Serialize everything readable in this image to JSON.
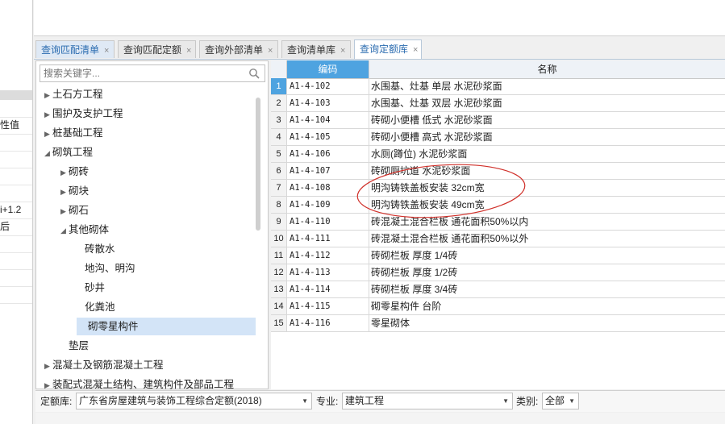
{
  "left_panel": {
    "rows": [
      {
        "text": ""
      },
      {
        "text": "性值"
      },
      {
        "text": ""
      },
      {
        "text": ""
      },
      {
        "text": ""
      },
      {
        "text": ""
      },
      {
        "text": "i+1.2"
      },
      {
        "text": "后"
      },
      {
        "text": ""
      },
      {
        "text": ""
      },
      {
        "text": ""
      },
      {
        "text": ""
      }
    ]
  },
  "tabs": [
    {
      "label": "查询匹配清单",
      "close": "×"
    },
    {
      "label": "查询匹配定额",
      "close": "×"
    },
    {
      "label": "查询外部清单",
      "close": "×"
    },
    {
      "label": "查询清单库",
      "close": "×"
    },
    {
      "label": "查询定额库",
      "close": "×"
    }
  ],
  "search": {
    "placeholder": "搜索关键字..."
  },
  "tree": [
    {
      "label": "土石方工程",
      "arrow": "▶"
    },
    {
      "label": "围护及支护工程",
      "arrow": "▶"
    },
    {
      "label": "桩基础工程",
      "arrow": "▶"
    },
    {
      "label": "砌筑工程",
      "arrow": "◢"
    },
    {
      "label": "砌砖",
      "arrow": "▶"
    },
    {
      "label": "砌块",
      "arrow": "▶"
    },
    {
      "label": "砌石",
      "arrow": "▶"
    },
    {
      "label": "其他砌体",
      "arrow": "◢"
    },
    {
      "label": "砖散水",
      "arrow": ""
    },
    {
      "label": "地沟、明沟",
      "arrow": ""
    },
    {
      "label": "砂井",
      "arrow": ""
    },
    {
      "label": "化粪池",
      "arrow": ""
    },
    {
      "label": "砌零星构件",
      "arrow": ""
    },
    {
      "label": "垫层",
      "arrow": ""
    },
    {
      "label": "混凝土及钢筋混凝土工程",
      "arrow": "▶"
    },
    {
      "label": "装配式混凝土结构、建筑构件及部品工程",
      "arrow": "▶"
    }
  ],
  "grid": {
    "headers": {
      "code": "编码",
      "name": "名称"
    },
    "rows": [
      {
        "no": "1",
        "code": "A1-4-102",
        "name": "水围基、灶基 单层 水泥砂浆面"
      },
      {
        "no": "2",
        "code": "A1-4-103",
        "name": "水围基、灶基 双层 水泥砂浆面"
      },
      {
        "no": "3",
        "code": "A1-4-104",
        "name": "砖砌小便槽 低式 水泥砂浆面"
      },
      {
        "no": "4",
        "code": "A1-4-105",
        "name": "砖砌小便槽 高式 水泥砂浆面"
      },
      {
        "no": "5",
        "code": "A1-4-106",
        "name": "水厕(蹲位) 水泥砂浆面"
      },
      {
        "no": "6",
        "code": "A1-4-107",
        "name": "砖砌厕坑道 水泥砂浆面"
      },
      {
        "no": "7",
        "code": "A1-4-108",
        "name": "明沟铸铁盖板安装 32cm宽"
      },
      {
        "no": "8",
        "code": "A1-4-109",
        "name": "明沟铸铁盖板安装 49cm宽"
      },
      {
        "no": "9",
        "code": "A1-4-110",
        "name": "砖混凝土混合栏板 通花面积50%以内"
      },
      {
        "no": "10",
        "code": "A1-4-111",
        "name": "砖混凝土混合栏板 通花面积50%以外"
      },
      {
        "no": "11",
        "code": "A1-4-112",
        "name": "砖砌栏板 厚度 1/4砖"
      },
      {
        "no": "12",
        "code": "A1-4-113",
        "name": "砖砌栏板 厚度 1/2砖"
      },
      {
        "no": "13",
        "code": "A1-4-114",
        "name": "砖砌栏板 厚度 3/4砖"
      },
      {
        "no": "14",
        "code": "A1-4-115",
        "name": "砌零星构件 台阶"
      },
      {
        "no": "15",
        "code": "A1-4-116",
        "name": "零星砌体"
      }
    ]
  },
  "bottom": {
    "quota_label": "定额库:",
    "quota_value": "广东省房屋建筑与装饰工程综合定额(2018)",
    "major_label": "专业:",
    "major_value": "建筑工程",
    "category_label": "类别:",
    "category_value": "全部"
  },
  "colors": {
    "accent": "#4ea3e0",
    "tab_text": "#2b6cb0",
    "annotation": "#d0302a"
  }
}
